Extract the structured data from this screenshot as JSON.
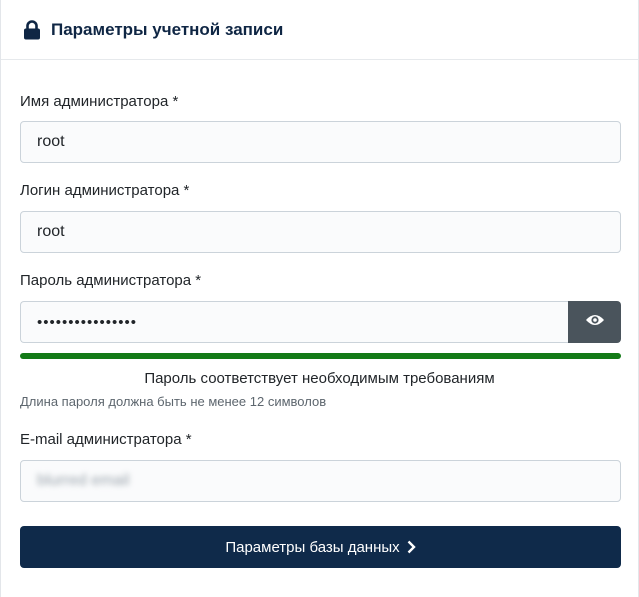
{
  "header": {
    "icon": "lock-icon",
    "title": "Параметры учетной записи"
  },
  "form": {
    "admin_name": {
      "label": "Имя администратора *",
      "value": "root"
    },
    "admin_login": {
      "label": "Логин администратора *",
      "value": "root"
    },
    "admin_password": {
      "label": "Пароль администратора *",
      "value": "••••••••••••••••",
      "toggle_icon": "eye-icon",
      "strength_percent": 100,
      "strength_color": "#137a17",
      "strength_message": "Пароль соответствует необходимым требованиям",
      "hint": "Длина пароля должна быть не менее 12 символов"
    },
    "admin_email": {
      "label": "E-mail администратора *",
      "value": "blurred email"
    }
  },
  "submit": {
    "label": "Параметры базы данных",
    "icon": "chevron-right-icon"
  },
  "colors": {
    "primary": "#0f2a4a",
    "success": "#137a17",
    "toggle": "#4a545c"
  }
}
